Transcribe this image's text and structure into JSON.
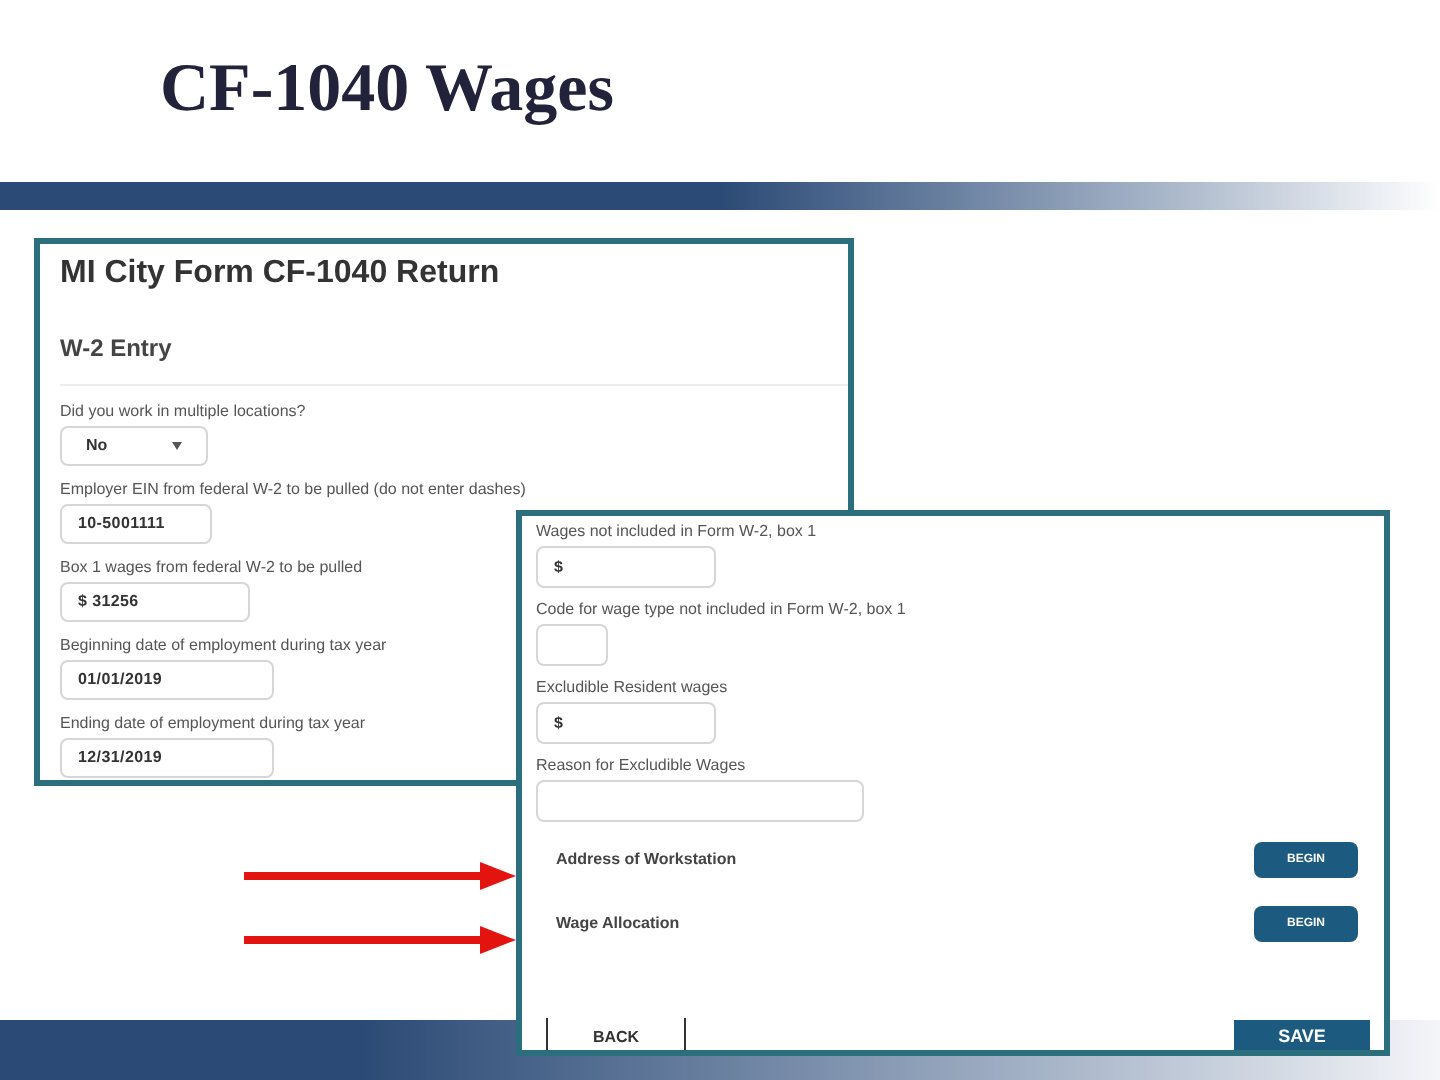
{
  "slide_title": "CF-1040 Wages",
  "form_panel": {
    "title": "MI City Form CF-1040 Return",
    "section": "W-2 Entry",
    "fields": [
      {
        "kind": "select",
        "label": "Did you work in multiple locations?",
        "value": "No"
      },
      {
        "kind": "input",
        "label": "Employer EIN from federal W-2 to be pulled (do not enter dashes)",
        "value": "10-5001111"
      },
      {
        "kind": "input",
        "label": "Box 1 wages from federal W-2 to be pulled",
        "value": "$ 31256"
      },
      {
        "kind": "input",
        "label": "Beginning date of employment during tax year",
        "value": "01/01/2019"
      },
      {
        "kind": "input",
        "label": "Ending date of employment during tax year",
        "value": "12/31/2019"
      }
    ]
  },
  "overlay_panel": {
    "fields": [
      {
        "label": "Wages not included in Form W-2, box 1",
        "value": "$"
      },
      {
        "label": "Code for wage type not included in Form W-2, box 1"
      },
      {
        "label": "Excludible Resident wages",
        "value": "$"
      },
      {
        "label": "Reason for Excludible Wages"
      }
    ],
    "sections": [
      {
        "label": "Address of Workstation",
        "button": "BEGIN"
      },
      {
        "label": "Wage Allocation",
        "button": "BEGIN"
      }
    ],
    "back_button": "BACK",
    "save_button": "SAVE"
  }
}
